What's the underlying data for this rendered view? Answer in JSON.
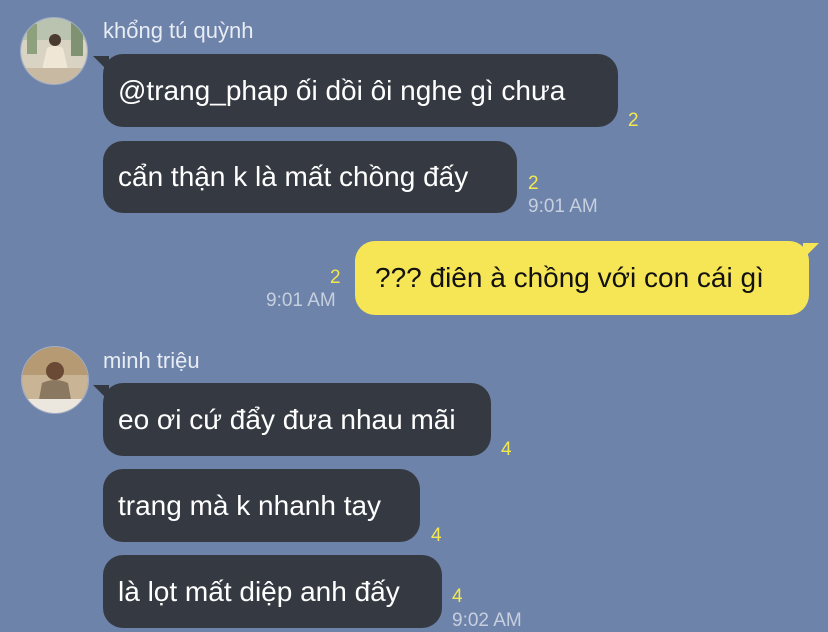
{
  "colors": {
    "background": "#6e83a9",
    "incoming_bubble": "#353a42",
    "outgoing_bubble": "#f6e656",
    "unread_count": "#f3e84f"
  },
  "group1": {
    "sender": "khổng tú quỳnh",
    "avatar": "avatar-photo",
    "messages": [
      {
        "text": "@trang_phap ối dồi ôi nghe gì chưa",
        "count": "2"
      },
      {
        "text": "cẩn thận k là mất chồng đấy",
        "count": "2",
        "time": "9:01 AM"
      }
    ]
  },
  "outgoing": {
    "text": "??? điên à chồng với con cái gì",
    "count": "2",
    "time": "9:01 AM"
  },
  "group2": {
    "sender": "minh triệu",
    "avatar": "avatar-photo",
    "messages": [
      {
        "text": "eo ơi cứ đẩy đưa nhau mãi",
        "count": "4"
      },
      {
        "text": "trang mà k nhanh tay",
        "count": "4"
      },
      {
        "text": "là lọt mất diệp anh đấy",
        "count": "4",
        "time": "9:02 AM"
      }
    ]
  }
}
